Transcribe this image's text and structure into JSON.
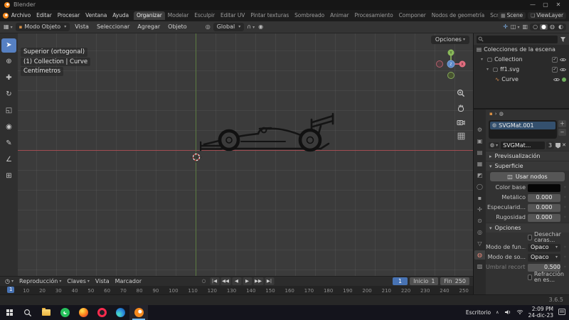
{
  "window": {
    "title": "Blender",
    "controls": [
      "—",
      "▢",
      "✕"
    ]
  },
  "menubar": {
    "menus": [
      "Archivo",
      "Editar",
      "Procesar",
      "Ventana",
      "Ayuda"
    ],
    "workspaces": [
      "Organizar",
      "Modelar",
      "Esculpir",
      "Editar UV",
      "Pintar texturas",
      "Sombreado",
      "Animar",
      "Procesamiento",
      "Componer",
      "Nodos de geometría",
      "Script"
    ],
    "active_workspace": "Organizar",
    "scene_name": "Scene",
    "viewlayer_name": "ViewLayer",
    "scene_icon": "▦",
    "viewlayer_icon": "❏"
  },
  "header": {
    "editor_icon": "▦",
    "mode_icon": "▪",
    "mode_label": "Modo Objeto",
    "menus": [
      "Vista",
      "Seleccionar",
      "Agregar",
      "Objeto"
    ],
    "pivot_icon": "◎",
    "orientation_label": "Global",
    "snap_icon": "∩",
    "falloff_icon": "◉",
    "xray_icon": "▥",
    "overlays_icon": "◫",
    "gizmos_icon": "✛",
    "shading_icons": [
      "○",
      "●",
      "◍",
      "◐"
    ]
  },
  "toolbar": {
    "tools": [
      {
        "name": "select-box",
        "glyph": "➤"
      },
      {
        "name": "cursor",
        "glyph": "⊕"
      },
      {
        "name": "move",
        "glyph": "✚"
      },
      {
        "name": "rotate",
        "glyph": "↻"
      },
      {
        "name": "scale",
        "glyph": "◱"
      },
      {
        "name": "transform",
        "glyph": "◉"
      },
      {
        "name": "annotate",
        "glyph": "✎"
      },
      {
        "name": "measure",
        "glyph": "∠"
      },
      {
        "name": "add-cube",
        "glyph": "⊞"
      }
    ]
  },
  "viewport": {
    "view_label": "Superior (ortogonal)",
    "context_label": "(1) Collection | Curve",
    "units_label": "Centímetros",
    "options_label": "Opciones"
  },
  "outliner": {
    "items": [
      {
        "label": "Colecciones de la escena",
        "icon": "▤"
      },
      {
        "label": "Collection",
        "icon": "▢"
      },
      {
        "label": "ff1.svg",
        "icon": "▢"
      },
      {
        "label": "Curve",
        "icon": "∿"
      }
    ]
  },
  "properties": {
    "tabs": [
      {
        "name": "tool",
        "glyph": "⚙"
      },
      {
        "name": "render",
        "glyph": "▣"
      },
      {
        "name": "output",
        "glyph": "▤"
      },
      {
        "name": "view-layer",
        "glyph": "▦"
      },
      {
        "name": "scene",
        "glyph": "◩"
      },
      {
        "name": "world",
        "glyph": "◯"
      },
      {
        "name": "object",
        "glyph": "▪"
      },
      {
        "name": "modifiers",
        "glyph": "✢"
      },
      {
        "name": "physics",
        "glyph": "⊙"
      },
      {
        "name": "constraints",
        "glyph": "◎"
      },
      {
        "name": "object-data",
        "glyph": "▽"
      },
      {
        "name": "material",
        "glyph": "◍"
      },
      {
        "name": "texture",
        "glyph": "▨"
      }
    ],
    "breadcrumb_icons": [
      "▪",
      "›",
      "◍"
    ],
    "slots": [
      "SVGMat.001"
    ],
    "slot_add_icon": "＋",
    "slot_remove_icon": "−",
    "slot_specials_icon": "▾",
    "sphere_icon": "◍",
    "datablock_name": "SVGMat...",
    "datablock_users": "3",
    "datablock_unlink_icon": "✕",
    "section_preview": "Previsualización",
    "section_surface": "Superficie",
    "section_options": "Opciones",
    "use_nodes_icon": "◫",
    "use_nodes_label": "Usar nodos",
    "base_color": "#000000",
    "surface_rows": [
      {
        "label": "Color base",
        "value": ""
      },
      {
        "label": "Metálico",
        "value": "0.000"
      },
      {
        "label": "Especularid...",
        "value": "0.000"
      },
      {
        "label": "Rugosidad",
        "value": "0.000"
      }
    ],
    "option_rows": [
      {
        "label": "Desechar caras..."
      },
      {
        "label": "Modo de fun...",
        "value": "Opaco"
      },
      {
        "label": "Modo de so...",
        "value": "Opaco"
      },
      {
        "label": "Umbral recorte",
        "value": "0.500"
      },
      {
        "label": "Refracción en es..."
      }
    ]
  },
  "timeline": {
    "editor_icon": "◷",
    "menus": [
      "Reproducción",
      "Claves",
      "Vista",
      "Marcador"
    ],
    "autokey_glyph": "○",
    "playback": [
      {
        "name": "jump-to-start",
        "glyph": "|◀"
      },
      {
        "name": "prev-keyframe",
        "glyph": "◀◀"
      },
      {
        "name": "play-reverse",
        "glyph": "◀"
      },
      {
        "name": "play-forward",
        "glyph": "▶"
      },
      {
        "name": "next-keyframe",
        "glyph": "▶▶"
      },
      {
        "name": "jump-to-end",
        "glyph": "▶|"
      }
    ],
    "current_frame": "1",
    "start_label": "Inicio",
    "start_value": "1",
    "end_label": "Fin",
    "end_value": "250",
    "ticks": [
      "1",
      "10",
      "20",
      "30",
      "40",
      "50",
      "60",
      "70",
      "80",
      "90",
      "100",
      "110",
      "120",
      "130",
      "140",
      "150",
      "160",
      "170",
      "180",
      "190",
      "200",
      "210",
      "220",
      "230",
      "240",
      "250"
    ]
  },
  "statusbar": {
    "version": "3.6.5"
  },
  "taskbar": {
    "desktop_label": "Escritorio",
    "tray_chevron": "∧",
    "time": "2:09 PM",
    "date": "24-dic-23"
  },
  "colors": {
    "accent": "#4772b3",
    "axis_x": "#a14d52",
    "axis_y": "#5c7c42",
    "selected": "#5680c2"
  }
}
